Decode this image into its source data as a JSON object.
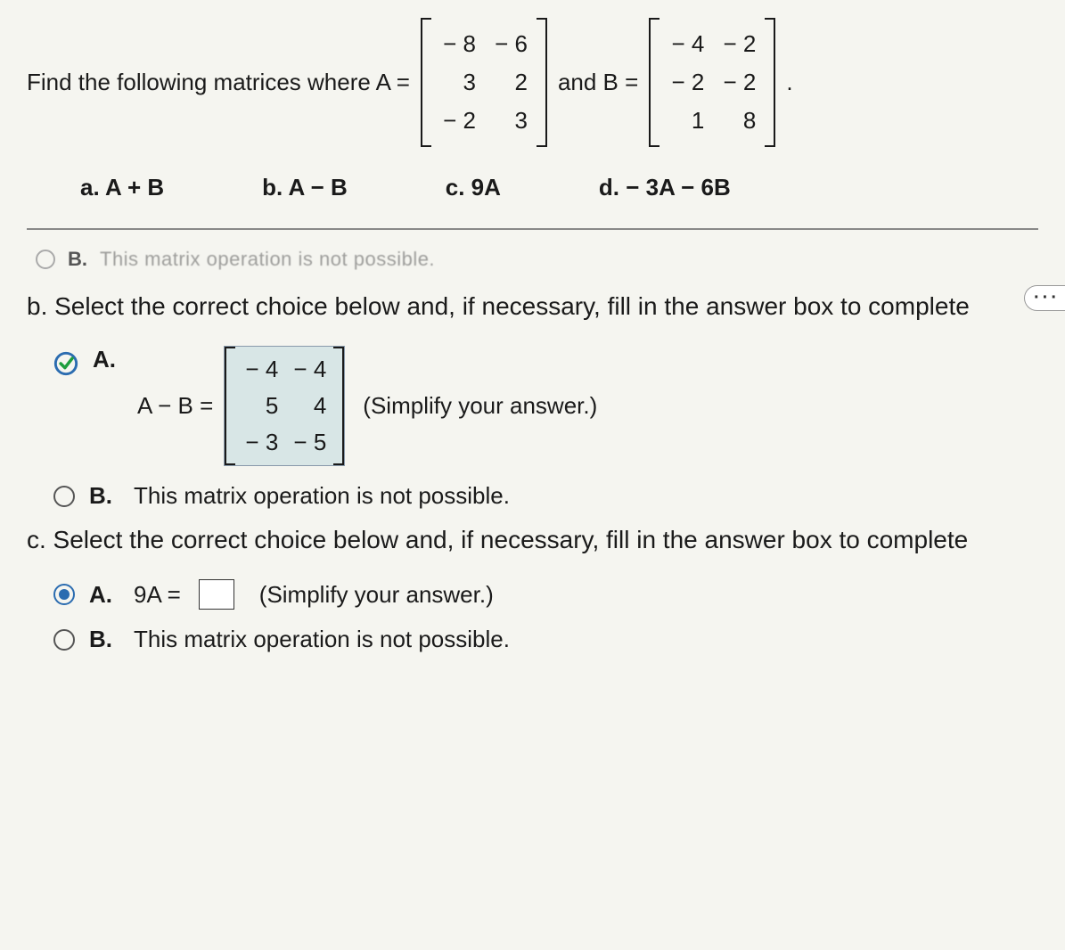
{
  "problem": {
    "intro_text": "Find the following matrices where A =",
    "and_text": "and B =",
    "period": ".",
    "matrixA": [
      "− 8",
      "− 6",
      "3",
      "2",
      "− 2",
      "3"
    ],
    "matrixB": [
      "− 4",
      "− 2",
      "− 2",
      "− 2",
      "1",
      "8"
    ],
    "subparts": {
      "a": "a. A + B",
      "b": "b. A − B",
      "c": "c. 9A",
      "d": "d. − 3A − 6B"
    }
  },
  "ellipsis": "···",
  "prev_line": {
    "label": "B.",
    "text": "This matrix operation is not possible."
  },
  "part_b": {
    "prompt": "b. Select the correct choice below and, if necessary, fill in the answer box to complete",
    "choice_a_label": "A.",
    "equation_lhs": "A − B =",
    "simplify": "(Simplify your answer.)",
    "answer_matrix": [
      "− 4",
      "− 4",
      "5",
      "4",
      "− 3",
      "− 5"
    ],
    "choice_b_label": "B.",
    "choice_b_text": "This matrix operation is not possible."
  },
  "part_c": {
    "prompt": "c. Select the correct choice below and, if necessary, fill in the answer box to complete",
    "choice_a_label": "A.",
    "equation_lhs": "9A =",
    "simplify": "(Simplify your answer.)",
    "choice_b_label": "B.",
    "choice_b_text": "This matrix operation is not possible."
  }
}
